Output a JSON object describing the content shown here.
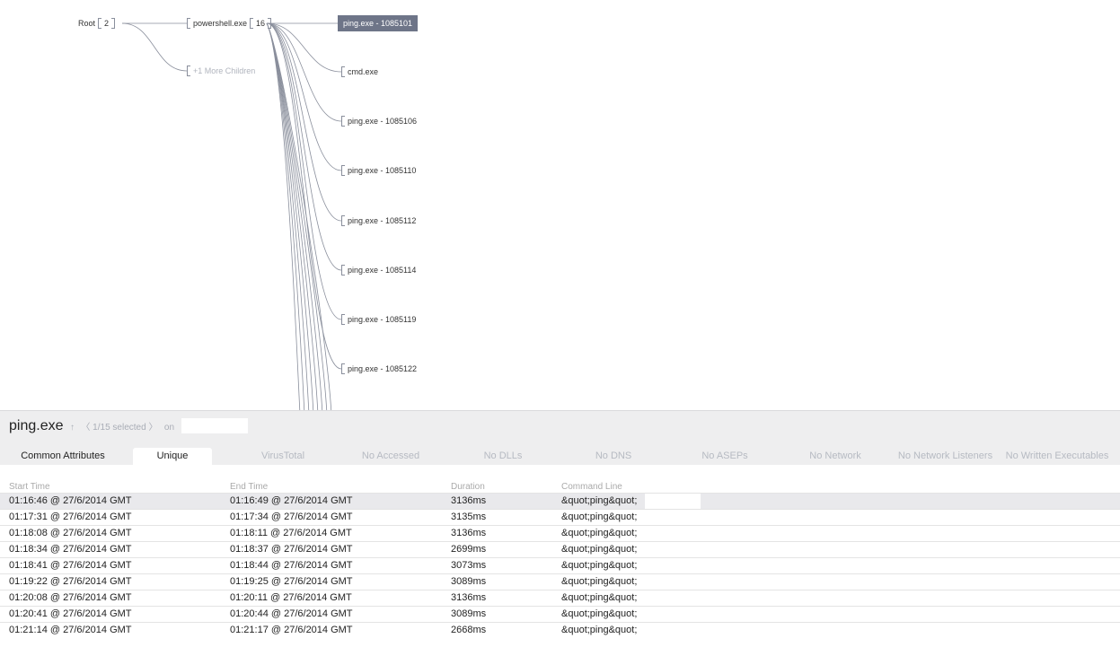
{
  "tree": {
    "root": {
      "label": "Root",
      "count": "2"
    },
    "parent": {
      "label": "powershell.exe",
      "count": "16"
    },
    "more_children": "+1 More Children",
    "children": [
      {
        "label": "ping.exe - 1085101",
        "selected": true
      },
      {
        "label": "cmd.exe",
        "selected": false
      },
      {
        "label": "ping.exe - 1085106",
        "selected": false
      },
      {
        "label": "ping.exe - 1085110",
        "selected": false
      },
      {
        "label": "ping.exe - 1085112",
        "selected": false
      },
      {
        "label": "ping.exe - 1085114",
        "selected": false
      },
      {
        "label": "ping.exe - 1085119",
        "selected": false
      },
      {
        "label": "ping.exe - 1085122",
        "selected": false
      }
    ]
  },
  "details": {
    "title": "ping.exe",
    "up_arrow": "↑",
    "selection": "〈 1/15 selected 〉",
    "on_label": "on",
    "tabs": [
      "Common Attributes",
      "Unique",
      "VirusTotal",
      "No Accessed",
      "No DLLs",
      "No DNS",
      "No ASEPs",
      "No Network",
      "No Network Listeners",
      "No Written Executables"
    ],
    "columns": [
      "Start Time",
      "End Time",
      "Duration",
      "Command Line"
    ],
    "rows": [
      [
        "01:16:46 @ 27/6/2014 GMT",
        "01:16:49 @ 27/6/2014 GMT",
        "3136ms",
        "&quot;ping&quot;"
      ],
      [
        "01:17:31 @ 27/6/2014 GMT",
        "01:17:34 @ 27/6/2014 GMT",
        "3135ms",
        "&quot;ping&quot;"
      ],
      [
        "01:18:08 @ 27/6/2014 GMT",
        "01:18:11 @ 27/6/2014 GMT",
        "3136ms",
        "&quot;ping&quot;"
      ],
      [
        "01:18:34 @ 27/6/2014 GMT",
        "01:18:37 @ 27/6/2014 GMT",
        "2699ms",
        "&quot;ping&quot;"
      ],
      [
        "01:18:41 @ 27/6/2014 GMT",
        "01:18:44 @ 27/6/2014 GMT",
        "3073ms",
        "&quot;ping&quot;"
      ],
      [
        "01:19:22 @ 27/6/2014 GMT",
        "01:19:25 @ 27/6/2014 GMT",
        "3089ms",
        "&quot;ping&quot;"
      ],
      [
        "01:20:08 @ 27/6/2014 GMT",
        "01:20:11 @ 27/6/2014 GMT",
        "3136ms",
        "&quot;ping&quot;"
      ],
      [
        "01:20:41 @ 27/6/2014 GMT",
        "01:20:44 @ 27/6/2014 GMT",
        "3089ms",
        "&quot;ping&quot;"
      ],
      [
        "01:21:14 @ 27/6/2014 GMT",
        "01:21:17 @ 27/6/2014 GMT",
        "2668ms",
        "&quot;ping&quot;"
      ]
    ]
  },
  "colors": {
    "accent": "#6e7588",
    "link": "#8a8f9c",
    "header_bg": "#eeeeef"
  }
}
